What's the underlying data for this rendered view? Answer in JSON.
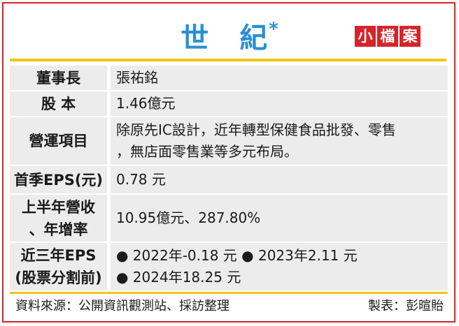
{
  "header": {
    "title_part1": "世",
    "title_part2": "紀",
    "title_mark": "*",
    "badge": [
      "小",
      "檔",
      "案"
    ]
  },
  "rows": [
    {
      "label": "董事長",
      "lines": [
        "張祐銘"
      ]
    },
    {
      "label": "股 本",
      "lines": [
        "1.46億元"
      ]
    },
    {
      "label": "營運項目",
      "lines": [
        "除原先IC設計，近年轉型保健食品批發、零售",
        "，無店面零售業等多元布局。"
      ]
    },
    {
      "label": "首季EPS(元)",
      "lines": [
        "0.78 元"
      ]
    },
    {
      "label_lines": [
        "上半年營收",
        "、年增率"
      ],
      "lines": [
        "10.95億元、287.80%"
      ]
    },
    {
      "label_lines": [
        "近三年EPS",
        "(股票分割前)"
      ],
      "lines": [
        "● 2022年-0.18 元 ● 2023年2.11 元",
        "● 2024年18.25 元"
      ]
    }
  ],
  "footer": {
    "source": "資料來源：公開資訊觀測站、採訪整理",
    "credit": "製表：彭暄貽"
  },
  "colors": {
    "border": "#d8232a",
    "title": "#2a8fd6",
    "badge_bg": "#d8232a",
    "rule": "#f2c417",
    "cell_bg": "#ececec"
  }
}
